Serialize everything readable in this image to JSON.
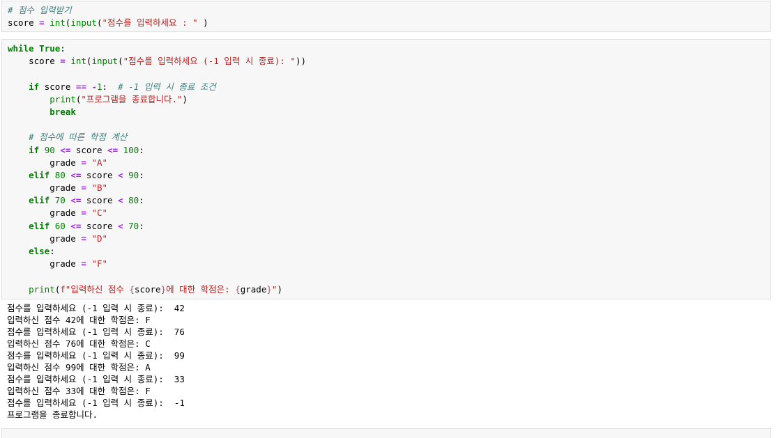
{
  "cells": [
    {
      "type": "code",
      "lines": [
        [
          {
            "t": "# 점수 입력받기",
            "c": "com"
          }
        ],
        [
          {
            "t": "score ",
            "c": "pl"
          },
          {
            "t": "=",
            "c": "op"
          },
          {
            "t": " ",
            "c": "pl"
          },
          {
            "t": "int",
            "c": "bi"
          },
          {
            "t": "(",
            "c": "pl"
          },
          {
            "t": "input",
            "c": "bi"
          },
          {
            "t": "(",
            "c": "pl"
          },
          {
            "t": "\"점수를 입력하세요 : \"",
            "c": "str"
          },
          {
            "t": " )",
            "c": "pl"
          }
        ]
      ]
    },
    {
      "type": "code",
      "lines": [
        [
          {
            "t": "while",
            "c": "kw"
          },
          {
            "t": " ",
            "c": "pl"
          },
          {
            "t": "True",
            "c": "kw"
          },
          {
            "t": ":",
            "c": "pl"
          }
        ],
        [
          {
            "t": "    score ",
            "c": "pl"
          },
          {
            "t": "=",
            "c": "op"
          },
          {
            "t": " ",
            "c": "pl"
          },
          {
            "t": "int",
            "c": "bi"
          },
          {
            "t": "(",
            "c": "pl"
          },
          {
            "t": "input",
            "c": "bi"
          },
          {
            "t": "(",
            "c": "pl"
          },
          {
            "t": "\"점수를 입력하세요 (-1 입력 시 종료): \"",
            "c": "str"
          },
          {
            "t": "))",
            "c": "pl"
          }
        ],
        [],
        [
          {
            "t": "    ",
            "c": "pl"
          },
          {
            "t": "if",
            "c": "kw"
          },
          {
            "t": " score ",
            "c": "pl"
          },
          {
            "t": "==",
            "c": "op"
          },
          {
            "t": " ",
            "c": "pl"
          },
          {
            "t": "-",
            "c": "op"
          },
          {
            "t": "1",
            "c": "num"
          },
          {
            "t": ":  ",
            "c": "pl"
          },
          {
            "t": "# -1 입력 시 종료 조건",
            "c": "com"
          }
        ],
        [
          {
            "t": "        ",
            "c": "pl"
          },
          {
            "t": "print",
            "c": "bi"
          },
          {
            "t": "(",
            "c": "pl"
          },
          {
            "t": "\"프로그램을 종료합니다.\"",
            "c": "str"
          },
          {
            "t": ")",
            "c": "pl"
          }
        ],
        [
          {
            "t": "        ",
            "c": "pl"
          },
          {
            "t": "break",
            "c": "kw"
          }
        ],
        [],
        [
          {
            "t": "    ",
            "c": "pl"
          },
          {
            "t": "# 점수에 따른 학점 계산",
            "c": "com"
          }
        ],
        [
          {
            "t": "    ",
            "c": "pl"
          },
          {
            "t": "if",
            "c": "kw"
          },
          {
            "t": " ",
            "c": "pl"
          },
          {
            "t": "90",
            "c": "num"
          },
          {
            "t": " ",
            "c": "pl"
          },
          {
            "t": "<=",
            "c": "op"
          },
          {
            "t": " score ",
            "c": "pl"
          },
          {
            "t": "<=",
            "c": "op"
          },
          {
            "t": " ",
            "c": "pl"
          },
          {
            "t": "100",
            "c": "num"
          },
          {
            "t": ":",
            "c": "pl"
          }
        ],
        [
          {
            "t": "        grade ",
            "c": "pl"
          },
          {
            "t": "=",
            "c": "op"
          },
          {
            "t": " ",
            "c": "pl"
          },
          {
            "t": "\"A\"",
            "c": "str"
          }
        ],
        [
          {
            "t": "    ",
            "c": "pl"
          },
          {
            "t": "elif",
            "c": "kw"
          },
          {
            "t": " ",
            "c": "pl"
          },
          {
            "t": "80",
            "c": "num"
          },
          {
            "t": " ",
            "c": "pl"
          },
          {
            "t": "<=",
            "c": "op"
          },
          {
            "t": " score ",
            "c": "pl"
          },
          {
            "t": "<",
            "c": "op"
          },
          {
            "t": " ",
            "c": "pl"
          },
          {
            "t": "90",
            "c": "num"
          },
          {
            "t": ":",
            "c": "pl"
          }
        ],
        [
          {
            "t": "        grade ",
            "c": "pl"
          },
          {
            "t": "=",
            "c": "op"
          },
          {
            "t": " ",
            "c": "pl"
          },
          {
            "t": "\"B\"",
            "c": "str"
          }
        ],
        [
          {
            "t": "    ",
            "c": "pl"
          },
          {
            "t": "elif",
            "c": "kw"
          },
          {
            "t": " ",
            "c": "pl"
          },
          {
            "t": "70",
            "c": "num"
          },
          {
            "t": " ",
            "c": "pl"
          },
          {
            "t": "<=",
            "c": "op"
          },
          {
            "t": " score ",
            "c": "pl"
          },
          {
            "t": "<",
            "c": "op"
          },
          {
            "t": " ",
            "c": "pl"
          },
          {
            "t": "80",
            "c": "num"
          },
          {
            "t": ":",
            "c": "pl"
          }
        ],
        [
          {
            "t": "        grade ",
            "c": "pl"
          },
          {
            "t": "=",
            "c": "op"
          },
          {
            "t": " ",
            "c": "pl"
          },
          {
            "t": "\"C\"",
            "c": "str"
          }
        ],
        [
          {
            "t": "    ",
            "c": "pl"
          },
          {
            "t": "elif",
            "c": "kw"
          },
          {
            "t": " ",
            "c": "pl"
          },
          {
            "t": "60",
            "c": "num"
          },
          {
            "t": " ",
            "c": "pl"
          },
          {
            "t": "<=",
            "c": "op"
          },
          {
            "t": " score ",
            "c": "pl"
          },
          {
            "t": "<",
            "c": "op"
          },
          {
            "t": " ",
            "c": "pl"
          },
          {
            "t": "70",
            "c": "num"
          },
          {
            "t": ":",
            "c": "pl"
          }
        ],
        [
          {
            "t": "        grade ",
            "c": "pl"
          },
          {
            "t": "=",
            "c": "op"
          },
          {
            "t": " ",
            "c": "pl"
          },
          {
            "t": "\"D\"",
            "c": "str"
          }
        ],
        [
          {
            "t": "    ",
            "c": "pl"
          },
          {
            "t": "else",
            "c": "kw"
          },
          {
            "t": ":",
            "c": "pl"
          }
        ],
        [
          {
            "t": "        grade ",
            "c": "pl"
          },
          {
            "t": "=",
            "c": "op"
          },
          {
            "t": " ",
            "c": "pl"
          },
          {
            "t": "\"F\"",
            "c": "str"
          }
        ],
        [],
        [
          {
            "t": "    ",
            "c": "pl"
          },
          {
            "t": "print",
            "c": "bi"
          },
          {
            "t": "(",
            "c": "pl"
          },
          {
            "t": "f\"입력하신 점수 ",
            "c": "str"
          },
          {
            "t": "{",
            "c": "interp"
          },
          {
            "t": "score",
            "c": "pl"
          },
          {
            "t": "}",
            "c": "interp"
          },
          {
            "t": "에 대한 학점은: ",
            "c": "str"
          },
          {
            "t": "{",
            "c": "interp"
          },
          {
            "t": "grade",
            "c": "pl"
          },
          {
            "t": "}",
            "c": "interp"
          },
          {
            "t": "\"",
            "c": "str"
          },
          {
            "t": ")",
            "c": "pl"
          }
        ]
      ]
    },
    {
      "type": "code",
      "lines": [
        []
      ]
    }
  ],
  "output": [
    "점수를 입력하세요 (-1 입력 시 종료):  42",
    "입력하신 점수 42에 대한 학점은: F",
    "점수를 입력하세요 (-1 입력 시 종료):  76",
    "입력하신 점수 76에 대한 학점은: C",
    "점수를 입력하세요 (-1 입력 시 종료):  99",
    "입력하신 점수 99에 대한 학점은: A",
    "점수를 입력하세요 (-1 입력 시 종료):  33",
    "입력하신 점수 33에 대한 학점은: F",
    "점수를 입력하세요 (-1 입력 시 종료):  -1",
    "프로그램을 종료합니다."
  ]
}
